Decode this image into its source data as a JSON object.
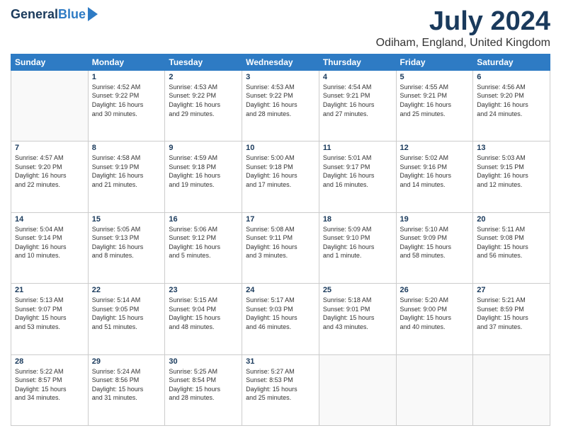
{
  "logo": {
    "general": "General",
    "blue": "Blue"
  },
  "header": {
    "month_title": "July 2024",
    "location": "Odiham, England, United Kingdom"
  },
  "days_of_week": [
    "Sunday",
    "Monday",
    "Tuesday",
    "Wednesday",
    "Thursday",
    "Friday",
    "Saturday"
  ],
  "weeks": [
    [
      {
        "day": "",
        "info": ""
      },
      {
        "day": "1",
        "info": "Sunrise: 4:52 AM\nSunset: 9:22 PM\nDaylight: 16 hours\nand 30 minutes."
      },
      {
        "day": "2",
        "info": "Sunrise: 4:53 AM\nSunset: 9:22 PM\nDaylight: 16 hours\nand 29 minutes."
      },
      {
        "day": "3",
        "info": "Sunrise: 4:53 AM\nSunset: 9:22 PM\nDaylight: 16 hours\nand 28 minutes."
      },
      {
        "day": "4",
        "info": "Sunrise: 4:54 AM\nSunset: 9:21 PM\nDaylight: 16 hours\nand 27 minutes."
      },
      {
        "day": "5",
        "info": "Sunrise: 4:55 AM\nSunset: 9:21 PM\nDaylight: 16 hours\nand 25 minutes."
      },
      {
        "day": "6",
        "info": "Sunrise: 4:56 AM\nSunset: 9:20 PM\nDaylight: 16 hours\nand 24 minutes."
      }
    ],
    [
      {
        "day": "7",
        "info": "Sunrise: 4:57 AM\nSunset: 9:20 PM\nDaylight: 16 hours\nand 22 minutes."
      },
      {
        "day": "8",
        "info": "Sunrise: 4:58 AM\nSunset: 9:19 PM\nDaylight: 16 hours\nand 21 minutes."
      },
      {
        "day": "9",
        "info": "Sunrise: 4:59 AM\nSunset: 9:18 PM\nDaylight: 16 hours\nand 19 minutes."
      },
      {
        "day": "10",
        "info": "Sunrise: 5:00 AM\nSunset: 9:18 PM\nDaylight: 16 hours\nand 17 minutes."
      },
      {
        "day": "11",
        "info": "Sunrise: 5:01 AM\nSunset: 9:17 PM\nDaylight: 16 hours\nand 16 minutes."
      },
      {
        "day": "12",
        "info": "Sunrise: 5:02 AM\nSunset: 9:16 PM\nDaylight: 16 hours\nand 14 minutes."
      },
      {
        "day": "13",
        "info": "Sunrise: 5:03 AM\nSunset: 9:15 PM\nDaylight: 16 hours\nand 12 minutes."
      }
    ],
    [
      {
        "day": "14",
        "info": "Sunrise: 5:04 AM\nSunset: 9:14 PM\nDaylight: 16 hours\nand 10 minutes."
      },
      {
        "day": "15",
        "info": "Sunrise: 5:05 AM\nSunset: 9:13 PM\nDaylight: 16 hours\nand 8 minutes."
      },
      {
        "day": "16",
        "info": "Sunrise: 5:06 AM\nSunset: 9:12 PM\nDaylight: 16 hours\nand 5 minutes."
      },
      {
        "day": "17",
        "info": "Sunrise: 5:08 AM\nSunset: 9:11 PM\nDaylight: 16 hours\nand 3 minutes."
      },
      {
        "day": "18",
        "info": "Sunrise: 5:09 AM\nSunset: 9:10 PM\nDaylight: 16 hours\nand 1 minute."
      },
      {
        "day": "19",
        "info": "Sunrise: 5:10 AM\nSunset: 9:09 PM\nDaylight: 15 hours\nand 58 minutes."
      },
      {
        "day": "20",
        "info": "Sunrise: 5:11 AM\nSunset: 9:08 PM\nDaylight: 15 hours\nand 56 minutes."
      }
    ],
    [
      {
        "day": "21",
        "info": "Sunrise: 5:13 AM\nSunset: 9:07 PM\nDaylight: 15 hours\nand 53 minutes."
      },
      {
        "day": "22",
        "info": "Sunrise: 5:14 AM\nSunset: 9:05 PM\nDaylight: 15 hours\nand 51 minutes."
      },
      {
        "day": "23",
        "info": "Sunrise: 5:15 AM\nSunset: 9:04 PM\nDaylight: 15 hours\nand 48 minutes."
      },
      {
        "day": "24",
        "info": "Sunrise: 5:17 AM\nSunset: 9:03 PM\nDaylight: 15 hours\nand 46 minutes."
      },
      {
        "day": "25",
        "info": "Sunrise: 5:18 AM\nSunset: 9:01 PM\nDaylight: 15 hours\nand 43 minutes."
      },
      {
        "day": "26",
        "info": "Sunrise: 5:20 AM\nSunset: 9:00 PM\nDaylight: 15 hours\nand 40 minutes."
      },
      {
        "day": "27",
        "info": "Sunrise: 5:21 AM\nSunset: 8:59 PM\nDaylight: 15 hours\nand 37 minutes."
      }
    ],
    [
      {
        "day": "28",
        "info": "Sunrise: 5:22 AM\nSunset: 8:57 PM\nDaylight: 15 hours\nand 34 minutes."
      },
      {
        "day": "29",
        "info": "Sunrise: 5:24 AM\nSunset: 8:56 PM\nDaylight: 15 hours\nand 31 minutes."
      },
      {
        "day": "30",
        "info": "Sunrise: 5:25 AM\nSunset: 8:54 PM\nDaylight: 15 hours\nand 28 minutes."
      },
      {
        "day": "31",
        "info": "Sunrise: 5:27 AM\nSunset: 8:53 PM\nDaylight: 15 hours\nand 25 minutes."
      },
      {
        "day": "",
        "info": ""
      },
      {
        "day": "",
        "info": ""
      },
      {
        "day": "",
        "info": ""
      }
    ]
  ]
}
